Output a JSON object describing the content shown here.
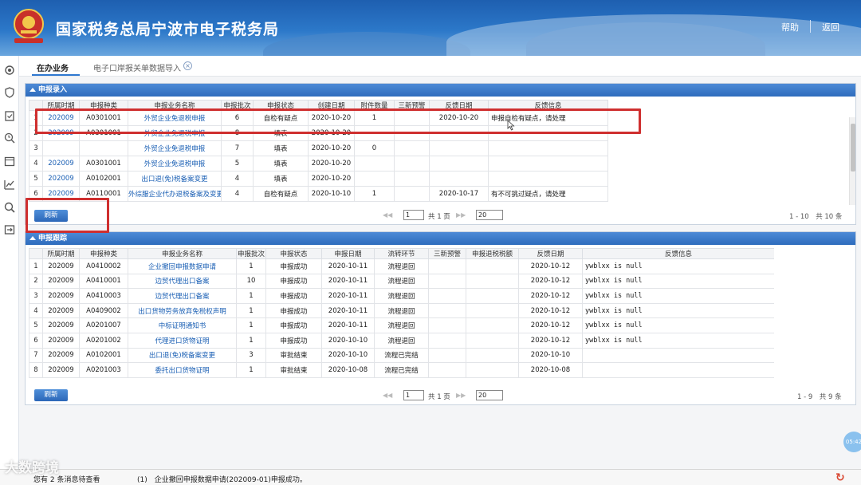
{
  "header": {
    "title": "国家税务总局宁波市电子税务局",
    "help": "帮助",
    "back": "返回",
    "colors": {
      "bar": "#2c78c9",
      "accent": "#cf2f2f"
    }
  },
  "rail_icons": [
    "settings-icon",
    "shield-icon",
    "clipboard-icon",
    "clock-search-icon",
    "calendar-icon",
    "chart-icon",
    "search-icon",
    "exit-icon"
  ],
  "tabs": {
    "active": "在办业务",
    "second": "电子口岸报关单数据导入"
  },
  "entry": {
    "title": "申报录入",
    "columns": [
      "",
      "所属时期",
      "申报种类",
      "申报业务名称",
      "申报批次",
      "申报状态",
      "创建日期",
      "附件数量",
      "三新预警",
      "反馈日期",
      "反馈信息"
    ],
    "rows": [
      [
        "1",
        "202009",
        "A0301001",
        "外贸企业免退税申报",
        "6",
        "自检有疑点",
        "2020-10-20",
        "1",
        "",
        "2020-10-20",
        "申报自检有疑点，请处理"
      ],
      [
        "2",
        "202009",
        "A0301001",
        "外贸企业免退税申报",
        "8",
        "填表",
        "2020-10-20",
        "",
        "",
        "",
        ""
      ],
      [
        "3",
        "",
        "",
        "外贸企业免退税申报",
        "7",
        "填表",
        "2020-10-20",
        "0",
        "",
        "",
        ""
      ],
      [
        "4",
        "202009",
        "A0301001",
        "外贸企业免退税申报",
        "5",
        "填表",
        "2020-10-20",
        "",
        "",
        "",
        ""
      ],
      [
        "5",
        "202009",
        "A0102001",
        "出口退(免)税备案变更",
        "4",
        "填表",
        "2020-10-20",
        "",
        "",
        "",
        ""
      ],
      [
        "6",
        "202009",
        "A0110001",
        "外综服企业代办退税备案及变更",
        "4",
        "自检有疑点",
        "2020-10-10",
        "1",
        "",
        "2020-10-17",
        "有不可挑过疑点，请处理"
      ]
    ],
    "refresh": "刷新",
    "pager": {
      "page": "1",
      "of": "共 1 页",
      "size": "20",
      "info": "1 - 10　共 10 条"
    }
  },
  "track": {
    "title": "申报跟踪",
    "columns": [
      "",
      "所属时期",
      "申报种类",
      "申报业务名称",
      "申报批次",
      "申报状态",
      "申报日期",
      "流转环节",
      "三新预警",
      "申报退税税额",
      "反馈日期",
      "反馈信息"
    ],
    "rows": [
      [
        "1",
        "202009",
        "A0410002",
        "企业撤回申报数据申请",
        "1",
        "申报成功",
        "2020-10-11",
        "流程退回",
        "",
        "",
        "2020-10-12",
        "ywblxx is null"
      ],
      [
        "2",
        "202009",
        "A0410001",
        "边贸代理出口备案",
        "10",
        "申报成功",
        "2020-10-11",
        "流程退回",
        "",
        "",
        "2020-10-12",
        "ywblxx is null"
      ],
      [
        "3",
        "202009",
        "A0410003",
        "边贸代理出口备案",
        "1",
        "申报成功",
        "2020-10-11",
        "流程退回",
        "",
        "",
        "2020-10-12",
        "ywblxx is null"
      ],
      [
        "4",
        "202009",
        "A0409002",
        "出口货物劳务放弃免税权声明",
        "1",
        "申报成功",
        "2020-10-11",
        "流程退回",
        "",
        "",
        "2020-10-12",
        "ywblxx is null"
      ],
      [
        "5",
        "202009",
        "A0201007",
        "中标证明通知书",
        "1",
        "申报成功",
        "2020-10-11",
        "流程退回",
        "",
        "",
        "2020-10-12",
        "ywblxx is null"
      ],
      [
        "6",
        "202009",
        "A0201002",
        "代理进口货物证明",
        "1",
        "申报成功",
        "2020-10-10",
        "流程退回",
        "",
        "",
        "2020-10-12",
        "ywblxx is null"
      ],
      [
        "7",
        "202009",
        "A0102001",
        "出口退(免)税备案变更",
        "3",
        "审批结束",
        "2020-10-10",
        "流程已完结",
        "",
        "",
        "2020-10-10",
        ""
      ],
      [
        "8",
        "202009",
        "A0201003",
        "委托出口货物证明",
        "1",
        "审批结束",
        "2020-10-08",
        "流程已完结",
        "",
        "",
        "2020-10-08",
        ""
      ]
    ],
    "refresh": "刷新",
    "pager": {
      "page": "1",
      "of": "共 1 页",
      "size": "20",
      "info": "1 - 9　共 9 条"
    }
  },
  "footer": {
    "pending": "您有 2 条消息待查看",
    "message": "(1)　企业撤回申报数据申请(202009-01)申报成功。",
    "watermark": "大数跨境",
    "clock": "05:42"
  }
}
